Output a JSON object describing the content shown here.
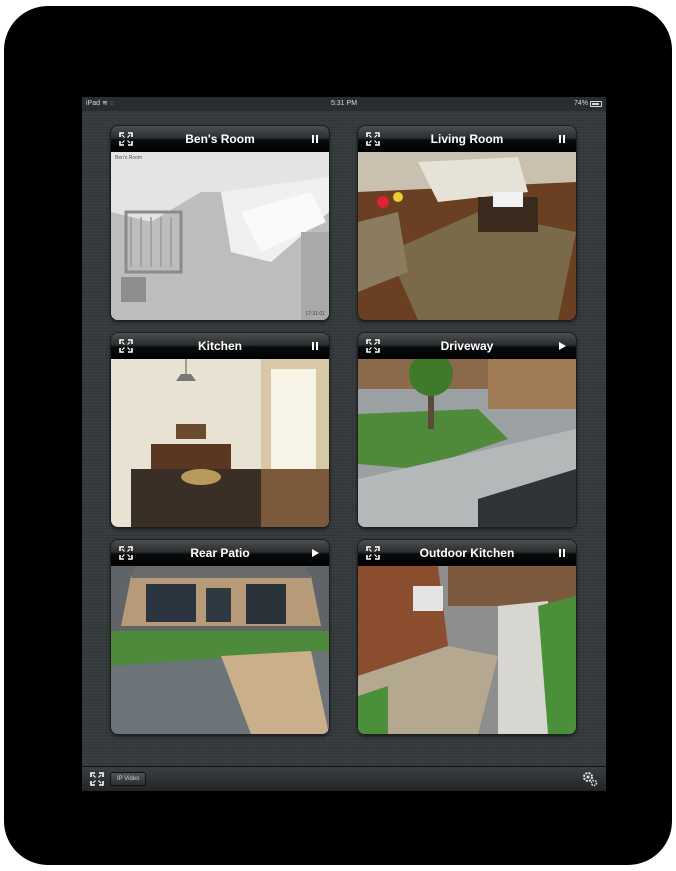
{
  "status_bar": {
    "device": "iPad",
    "time": "5:31 PM",
    "battery": "74%"
  },
  "cameras": [
    {
      "name": "Ben's Room",
      "control": "pause",
      "overlay_label": "Ben's Room",
      "overlay_time": "17:31:01"
    },
    {
      "name": "Living Room",
      "control": "pause"
    },
    {
      "name": "Kitchen",
      "control": "pause"
    },
    {
      "name": "Driveway",
      "control": "play"
    },
    {
      "name": "Rear Patio",
      "control": "play"
    },
    {
      "name": "Outdoor Kitchen",
      "control": "pause"
    }
  ],
  "bottom_bar": {
    "source_label": "IP Video",
    "settings_icon": "gear-icon",
    "expand_icon": "fullscreen-icon"
  },
  "colors": {
    "bezel": "#000000",
    "screen_bg": "#353a3d",
    "header_text": "#ffffff"
  }
}
